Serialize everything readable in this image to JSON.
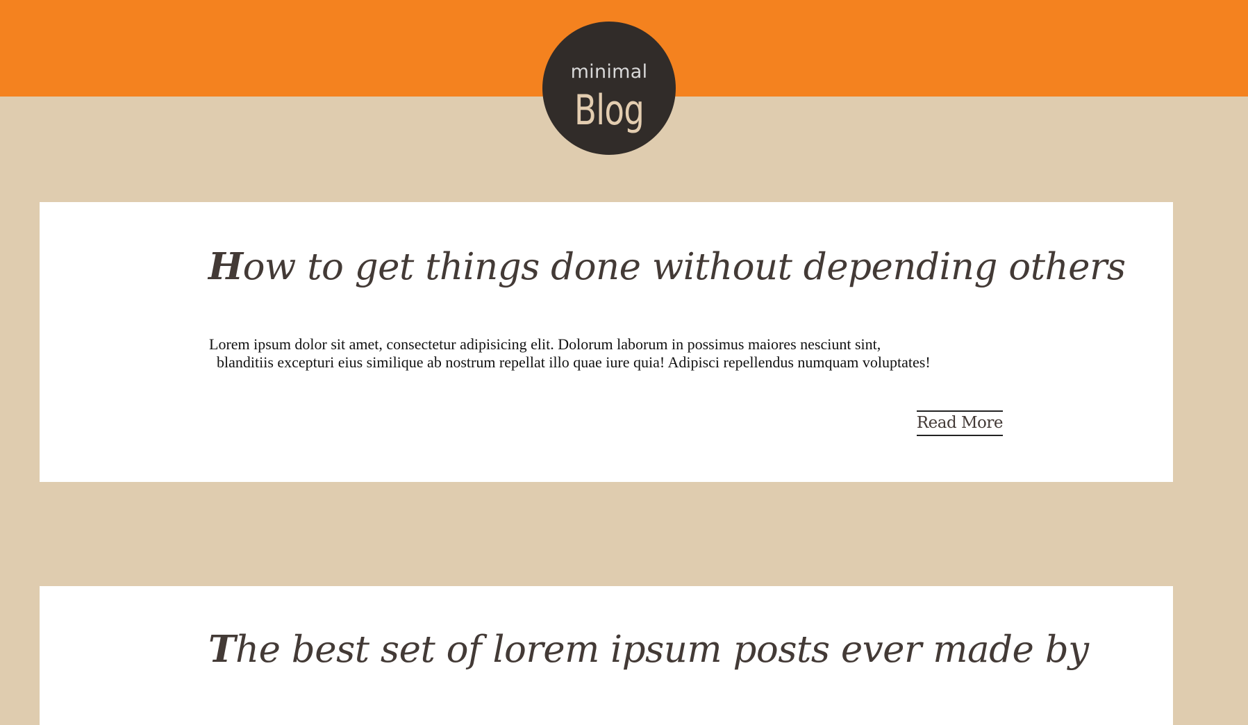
{
  "header": {
    "logo_small": "minimal",
    "logo_big": "Blog"
  },
  "posts": [
    {
      "title": "How to get things done without depending others",
      "excerpt_line_1": "Lorem ipsum dolor sit amet, consectetur adipisicing elit. Dolorum laborum in possimus maiores nesciunt sint,",
      "excerpt_line_2": "blanditiis excepturi eius similique ab nostrum repellat illo quae iure quia! Adipisci repellendus numquam voluptates!",
      "read_more": "Read More"
    },
    {
      "title": "The best set of lorem ipsum posts ever made by"
    }
  ],
  "colors": {
    "header_orange": "#f4821f",
    "page_background": "#dfccaf",
    "logo_circle": "#312c29",
    "title_text": "#433a36"
  }
}
